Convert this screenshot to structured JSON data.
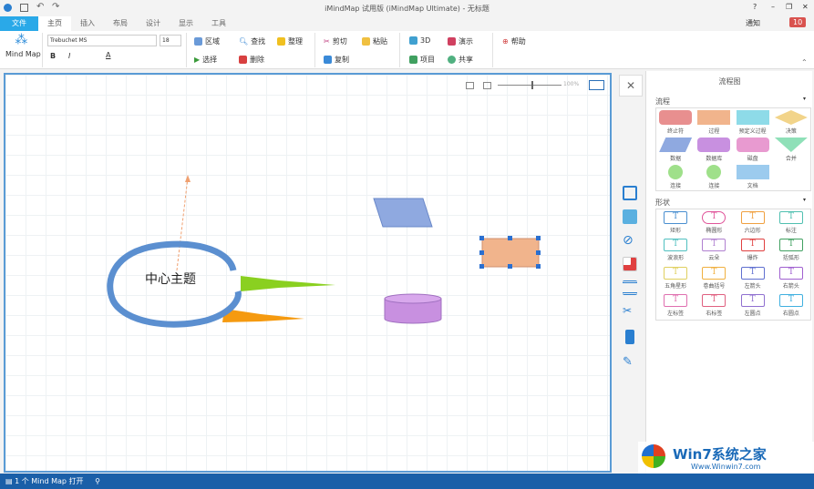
{
  "app": {
    "title": "iMindMap 试用版 (iMindMap Ultimate) - 无标题",
    "notify_label": "通知",
    "notify_count": "10",
    "help": "?",
    "minimize": "–",
    "restore": "❐",
    "close": "✕"
  },
  "tabs": [
    "文件",
    "主页",
    "插入",
    "布局",
    "设计",
    "显示",
    "工具"
  ],
  "ribbon": {
    "mindmap": "Mind Map",
    "font": "Trebuchet MS",
    "size": "18",
    "area": "区域",
    "find": "查找",
    "tidy": "整理",
    "cut": "剪切",
    "paste": "粘贴",
    "view3d": "3D",
    "present": "演示",
    "help": "帮助",
    "select": "选择",
    "delete": "删除",
    "copy": "复制",
    "project": "项目",
    "share": "共享",
    "bold": "B",
    "italic": "I",
    "fontcolor": "A"
  },
  "canvas": {
    "zoom": "100%",
    "central_topic": "中心主题"
  },
  "panel": {
    "title": "流程图",
    "close": "✕",
    "section1": "流程",
    "section2": "形状",
    "flow": [
      {
        "label": "终止符",
        "color": "#e88f8f"
      },
      {
        "label": "过程",
        "color": "#f1b48c"
      },
      {
        "label": "预定义过程",
        "color": "#8edbe8"
      },
      {
        "label": "决策",
        "color": "#f2d48a"
      },
      {
        "label": "数据",
        "color": "#8fa9e0"
      },
      {
        "label": "数据库",
        "color": "#c890e0"
      },
      {
        "label": "磁盘",
        "color": "#e89ad0"
      },
      {
        "label": "合并",
        "color": "#8fe0b8"
      },
      {
        "label": "连接",
        "color": "#9fe08a"
      },
      {
        "label": "连接",
        "color": "#9fe08a"
      },
      {
        "label": "文档",
        "color": "#9ccbee"
      }
    ],
    "shapes": [
      {
        "label": "矩形",
        "color": "#4a8fd0"
      },
      {
        "label": "椭圆形",
        "color": "#e0559a"
      },
      {
        "label": "六边形",
        "color": "#f0a040"
      },
      {
        "label": "标注",
        "color": "#50c0b0"
      },
      {
        "label": "波浪形",
        "color": "#50c0c0"
      },
      {
        "label": "云朵",
        "color": "#b080d0"
      },
      {
        "label": "爆炸",
        "color": "#e04040"
      },
      {
        "label": "括弧形",
        "color": "#40a060"
      },
      {
        "label": "五角星形",
        "color": "#e0d060"
      },
      {
        "label": "卷曲括号",
        "color": "#f0b040"
      },
      {
        "label": "左箭头",
        "color": "#6070d0"
      },
      {
        "label": "右箭头",
        "color": "#a060d0"
      },
      {
        "label": "左标签",
        "color": "#e070b0"
      },
      {
        "label": "右标签",
        "color": "#e06080"
      },
      {
        "label": "左圆点",
        "color": "#9070d0"
      },
      {
        "label": "右圆点",
        "color": "#40b0e0"
      }
    ]
  },
  "status": {
    "text": "1 个 Mind Map 打开"
  },
  "watermark": {
    "brand": "Win7系统之家",
    "url": "Www.Winwin7.com"
  }
}
